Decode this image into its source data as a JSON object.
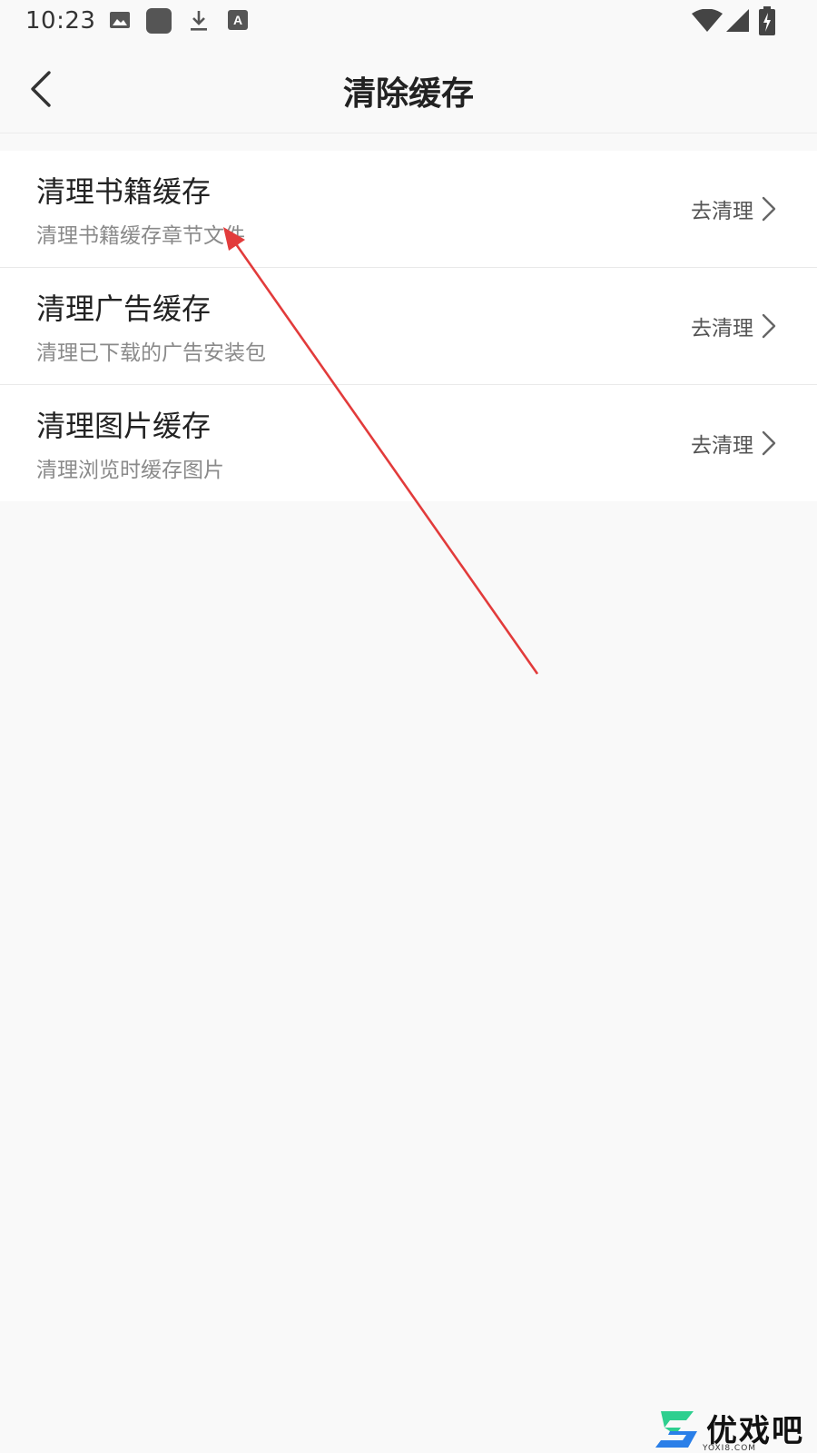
{
  "status_bar": {
    "time": "10:23",
    "left_icons": [
      "image-icon",
      "app-square-icon",
      "download-icon",
      "font-a-icon"
    ],
    "right_icons": [
      "wifi-icon",
      "cellular-signal-icon",
      "battery-charging-icon"
    ]
  },
  "header": {
    "title": "清除缓存",
    "back_icon": "chevron-left-icon"
  },
  "cache_items": [
    {
      "title": "清理书籍缓存",
      "desc": "清理书籍缓存章节文件",
      "action": "去清理"
    },
    {
      "title": "清理广告缓存",
      "desc": "清理已下载的广告安装包",
      "action": "去清理"
    },
    {
      "title": "清理图片缓存",
      "desc": "清理浏览时缓存图片",
      "action": "去清理"
    }
  ],
  "watermark": {
    "logo_text": "优戏吧",
    "sub_text": "YOXI8.COM"
  },
  "colors": {
    "background": "#f9f9f9",
    "card": "#ffffff",
    "annotation_arrow": "#e23b3b",
    "secondary_text": "#8a8a8a"
  }
}
